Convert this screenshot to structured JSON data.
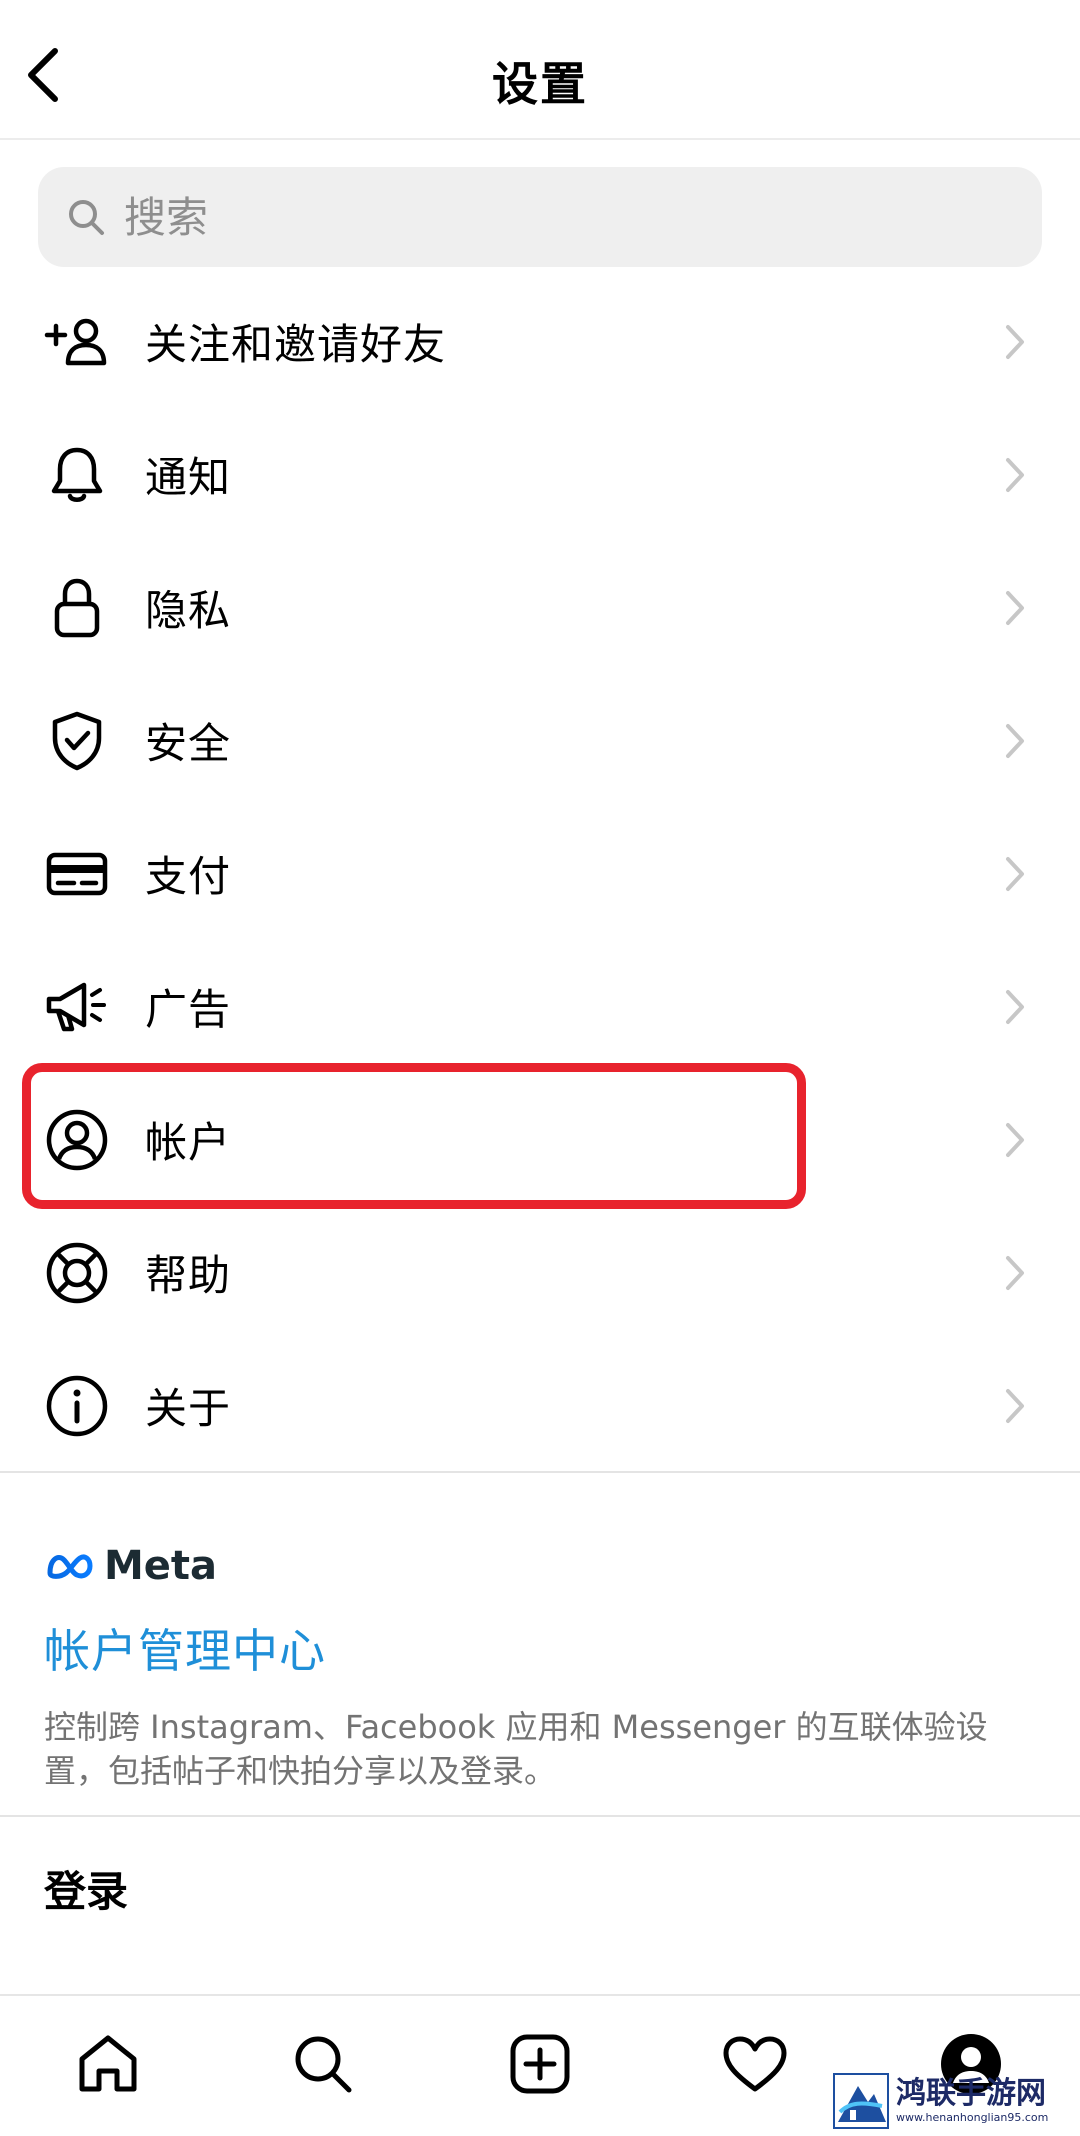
{
  "header": {
    "title": "设置",
    "back_icon": "chevron-left-icon"
  },
  "search": {
    "placeholder": "搜索",
    "value": "",
    "icon": "search-icon"
  },
  "menu": [
    {
      "label": "关注和邀请好友",
      "icon": "add-person-icon"
    },
    {
      "label": "通知",
      "icon": "bell-icon"
    },
    {
      "label": "隐私",
      "icon": "lock-icon"
    },
    {
      "label": "安全",
      "icon": "shield-check-icon"
    },
    {
      "label": "支付",
      "icon": "card-icon"
    },
    {
      "label": "广告",
      "icon": "megaphone-icon"
    },
    {
      "label": "帐户",
      "icon": "account-circle-icon",
      "highlighted": true
    },
    {
      "label": "帮助",
      "icon": "lifebuoy-icon"
    },
    {
      "label": "关于",
      "icon": "info-icon"
    }
  ],
  "meta": {
    "logo_text": "Meta",
    "center_link": "帐户管理中心",
    "description": "控制跨 Instagram、Facebook 应用和 Messenger 的互联体验设置，包括帖子和快拍分享以及登录。"
  },
  "login": {
    "label": "登录"
  },
  "bottom_nav": [
    "home-icon",
    "search-icon",
    "create-icon",
    "heart-icon",
    "profile-icon"
  ],
  "watermark": {
    "name": "鸿联手游网",
    "url": "www.henanhonglian95.com"
  },
  "colors": {
    "highlight": "#e8232d",
    "link": "#1f8fd8",
    "secondary_text": "#737373",
    "search_bg": "#efefef"
  }
}
